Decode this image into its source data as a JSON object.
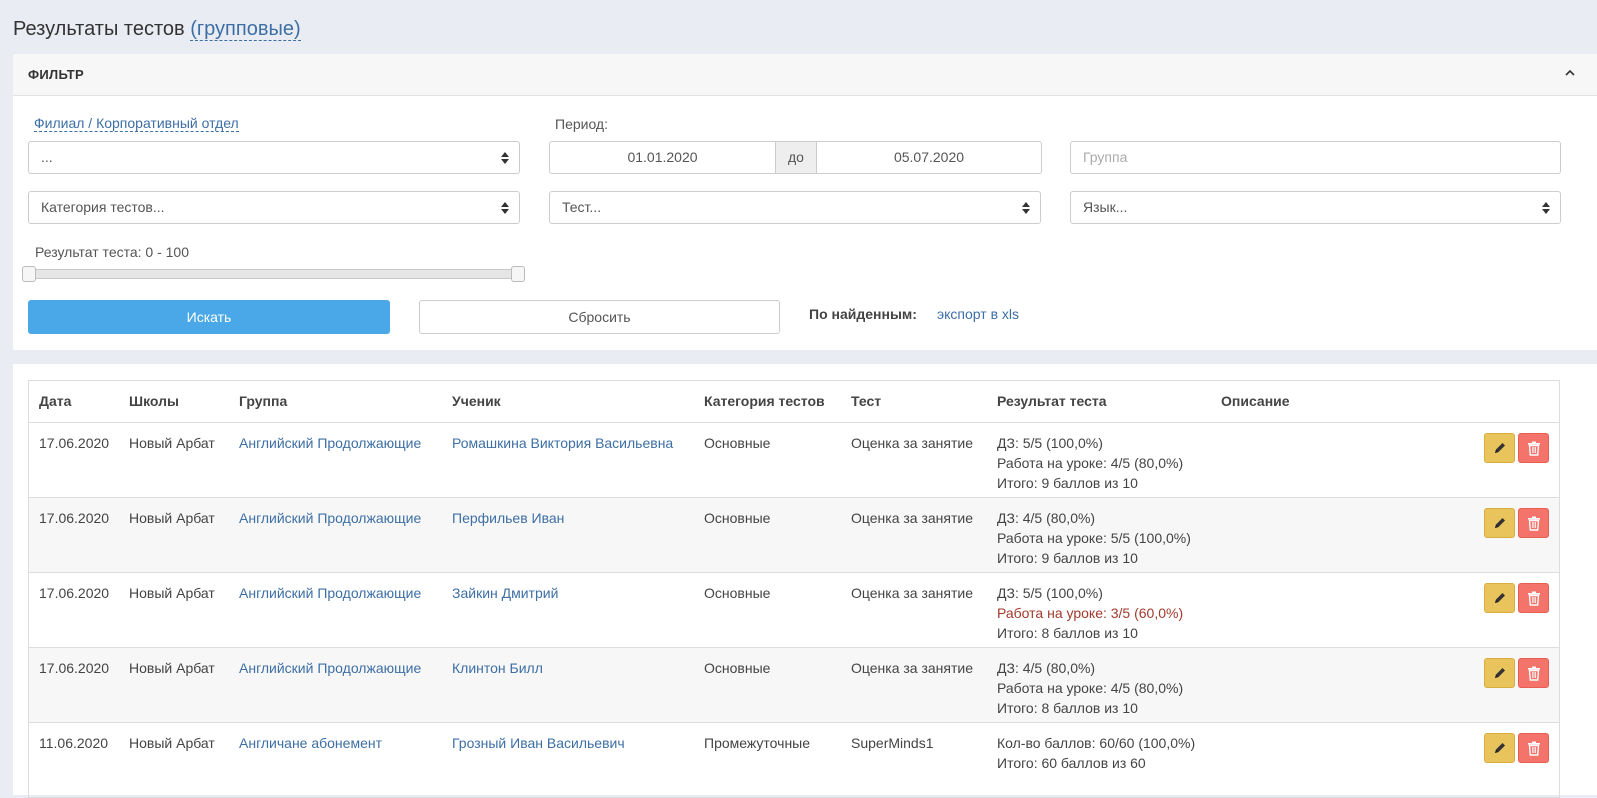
{
  "header": {
    "title": "Результаты тестов",
    "subtitle_link": "(групповые)"
  },
  "filter": {
    "title": "ФИЛЬТР",
    "branch_label": "Филиал / Корпоративный отдел",
    "branch_value": "...",
    "period_label": "Период:",
    "date_from": "01.01.2020",
    "date_sep": "до",
    "date_to": "05.07.2020",
    "group_placeholder": "Группа",
    "category_value": "Категория тестов...",
    "test_value": "Тест...",
    "language_value": "Язык...",
    "result_label": "Результат теста: 0 - 100",
    "result_range": [
      0,
      100
    ],
    "search_button": "Искать",
    "reset_button": "Сбросить",
    "found_label": "По найденным:",
    "export_link": "экспорт в xls"
  },
  "table": {
    "columns": [
      "Дата",
      "Школы",
      "Группа",
      "Ученик",
      "Категория тестов",
      "Тест",
      "Результат теста",
      "Описание"
    ],
    "rows": [
      {
        "date": "17.06.2020",
        "school": "Новый Арбат",
        "group": "Английский Продолжающие",
        "student": "Ромашкина Виктория Васильевна",
        "category": "Основные",
        "test": "Оценка за занятие",
        "result": [
          {
            "text": "ДЗ: 5/5 (100,0%)",
            "bad": false
          },
          {
            "text": "Работа на уроке: 4/5 (80,0%)",
            "bad": false
          },
          {
            "text": "Итого: 9 баллов из 10",
            "bad": false
          }
        ],
        "description": ""
      },
      {
        "date": "17.06.2020",
        "school": "Новый Арбат",
        "group": "Английский Продолжающие",
        "student": "Перфильев Иван",
        "category": "Основные",
        "test": "Оценка за занятие",
        "result": [
          {
            "text": "ДЗ: 4/5 (80,0%)",
            "bad": false
          },
          {
            "text": "Работа на уроке: 5/5 (100,0%)",
            "bad": false
          },
          {
            "text": "Итого: 9 баллов из 10",
            "bad": false
          }
        ],
        "description": ""
      },
      {
        "date": "17.06.2020",
        "school": "Новый Арбат",
        "group": "Английский Продолжающие",
        "student": "Зайкин Дмитрий",
        "category": "Основные",
        "test": "Оценка за занятие",
        "result": [
          {
            "text": "ДЗ: 5/5 (100,0%)",
            "bad": false
          },
          {
            "text": "Работа на уроке: 3/5 (60,0%)",
            "bad": true
          },
          {
            "text": "Итого: 8 баллов из 10",
            "bad": false
          }
        ],
        "description": ""
      },
      {
        "date": "17.06.2020",
        "school": "Новый Арбат",
        "group": "Английский Продолжающие",
        "student": "Клинтон Билл",
        "category": "Основные",
        "test": "Оценка за занятие",
        "result": [
          {
            "text": "ДЗ: 4/5 (80,0%)",
            "bad": false
          },
          {
            "text": "Работа на уроке: 4/5 (80,0%)",
            "bad": false
          },
          {
            "text": "Итого: 8 баллов из 10",
            "bad": false
          }
        ],
        "description": ""
      },
      {
        "date": "11.06.2020",
        "school": "Новый Арбат",
        "group": "Англичане абонемент",
        "student": "Грозный Иван Васильевич",
        "category": "Промежуточные",
        "test": "SuperMinds1",
        "result": [
          {
            "text": "Кол-во баллов: 60/60 (100,0%)",
            "bad": false
          },
          {
            "text": "Итого: 60 баллов из 60",
            "bad": false
          }
        ],
        "description": ""
      }
    ]
  },
  "icons": {
    "collapse": "chevron-up-icon",
    "select_arrows": "sort-arrows-icon",
    "edit": "pencil-icon",
    "delete": "trash-icon"
  },
  "colors": {
    "primary": "#4aa8e8",
    "link": "#3d6fa5",
    "edit": "#e9c35c",
    "delete": "#f4736a",
    "bad_result": "#a23b2c"
  }
}
